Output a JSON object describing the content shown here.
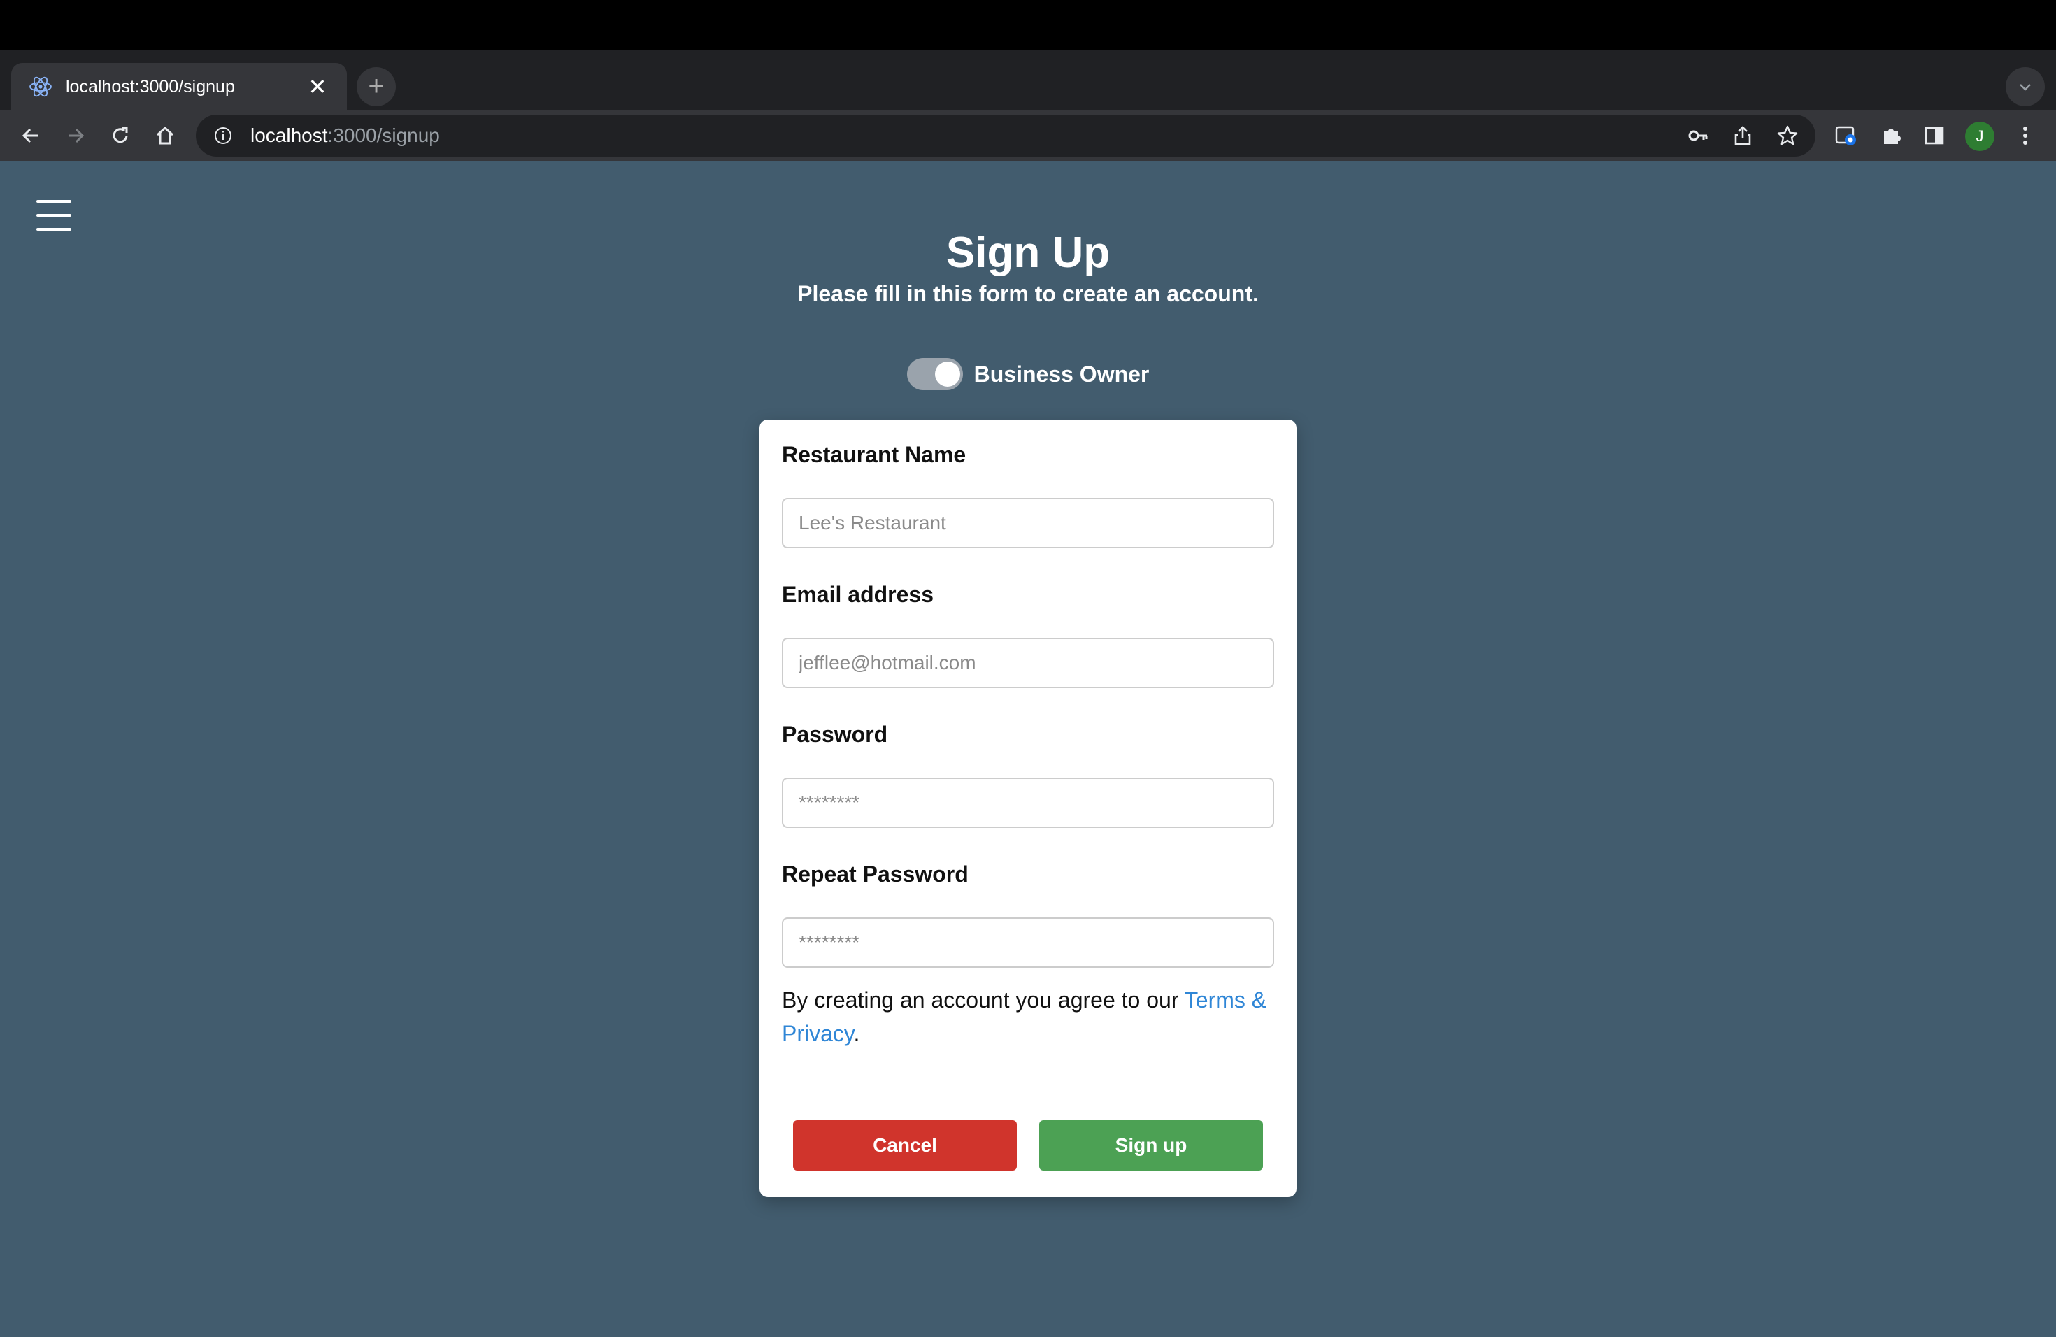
{
  "browser": {
    "tab": {
      "title": "localhost:3000/signup",
      "close_label": "✕",
      "favicon": "react-icon"
    },
    "new_tab_label": "+",
    "address": {
      "host": "localhost",
      "path": ":3000/signup"
    },
    "profile_initial": "J"
  },
  "page": {
    "title": "Sign Up",
    "subtitle": "Please fill in this form to create an account.",
    "toggle": {
      "label": "Business Owner",
      "on": true
    },
    "form": {
      "restaurant_name": {
        "label": "Restaurant Name",
        "placeholder": "Lee's Restaurant",
        "value": ""
      },
      "email": {
        "label": "Email address",
        "placeholder": "jefflee@hotmail.com",
        "value": ""
      },
      "password": {
        "label": "Password",
        "placeholder": "********",
        "value": ""
      },
      "repeat_password": {
        "label": "Repeat Password",
        "placeholder": "********",
        "value": ""
      }
    },
    "terms": {
      "text": "By creating an account you agree to our ",
      "link": "Terms & Privacy",
      "suffix": "."
    },
    "buttons": {
      "cancel": "Cancel",
      "signup": "Sign up"
    }
  },
  "colors": {
    "page_background": "#425c6e",
    "cancel": "#d0342c",
    "signup": "#4ca154",
    "link": "#2f86d6"
  }
}
